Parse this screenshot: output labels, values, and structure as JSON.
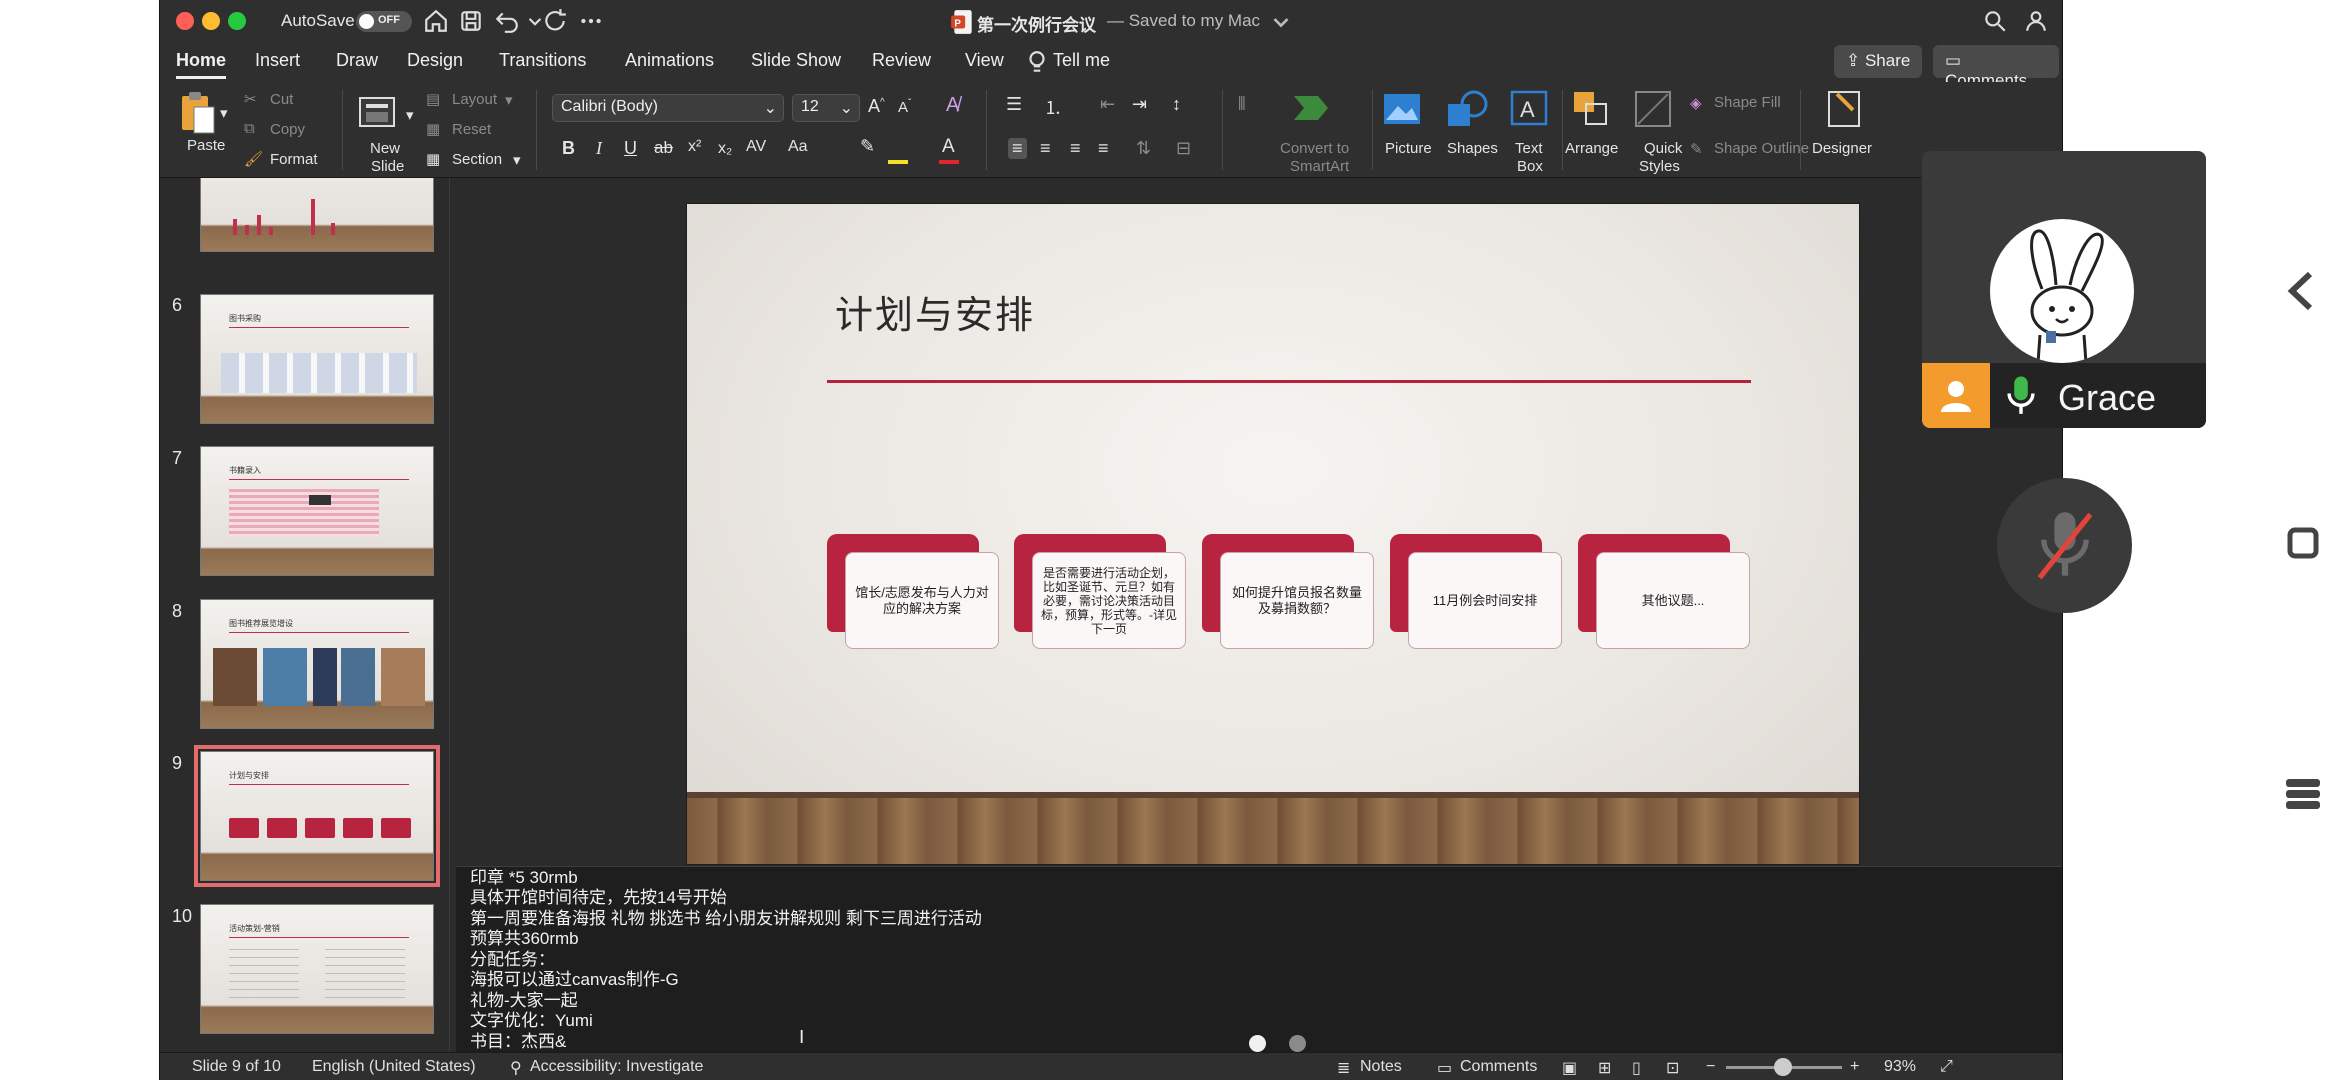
{
  "titlebar": {
    "autosave_label": "AutoSave",
    "autosave_state": "OFF",
    "doc_title": "第一次例行会议",
    "doc_status": "— Saved to my Mac"
  },
  "tabs": [
    "Home",
    "Insert",
    "Draw",
    "Design",
    "Transitions",
    "Animations",
    "Slide Show",
    "Review",
    "View",
    "Tell me"
  ],
  "active_tab": "Home",
  "share_label": "Share",
  "comments_label": "Comments",
  "ribbon": {
    "paste": "Paste",
    "cut": "Cut",
    "copy": "Copy",
    "format": "Format",
    "new_slide": "New\nSlide",
    "new_slide_l1": "New",
    "new_slide_l2": "Slide",
    "layout": "Layout",
    "reset": "Reset",
    "section": "Section",
    "font_name": "Calibri (Body)",
    "font_size": "12",
    "convert_l1": "Convert to",
    "convert_l2": "SmartArt",
    "picture": "Picture",
    "shapes": "Shapes",
    "textbox_l1": "Text",
    "textbox_l2": "Box",
    "arrange": "Arrange",
    "quick_l1": "Quick",
    "quick_l2": "Styles",
    "shape_fill": "Shape Fill",
    "shape_outline": "Shape Outline",
    "designer": "Designer"
  },
  "thumbnails": [
    {
      "num": "6",
      "title": "图书采购"
    },
    {
      "num": "7",
      "title": "书籍录入"
    },
    {
      "num": "8",
      "title": "图书推荐展览增设"
    },
    {
      "num": "9",
      "title": "计划与安排"
    },
    {
      "num": "10",
      "title": "活动策划-营销"
    }
  ],
  "selected_slide": "9",
  "slide": {
    "title": "计划与安排",
    "cards": [
      "馆长/志愿发布与人力对应的解决方案",
      "是否需要进行活动企划，比如圣诞节、元旦？如有必要，需讨论决策活动目标，预算，形式等。-详见下一页",
      "如何提升馆员报名数量及募捐数额？",
      "11月例会时间安排",
      "其他议题..."
    ]
  },
  "notes": [
    "印章 *5 30rmb",
    "具体开馆时间待定，先按14号开始",
    "第一周要准备海报 礼物 挑选书 给小朋友讲解规则 剩下三周进行活动",
    "预算共360rmb",
    "分配任务：",
    "海报可以通过canvas制作-G",
    "礼物-大家一起",
    "文字优化：Yumi",
    "书目：杰西&"
  ],
  "status": {
    "slide_pos": "Slide 9 of 10",
    "language": "English (United States)",
    "accessibility": "Accessibility: Investigate",
    "notes": "Notes",
    "comments": "Comments",
    "zoom": "93%"
  },
  "meeting": {
    "participant_name": "Grace"
  },
  "colors": {
    "accent_red": "#b5223e",
    "thumb_selected": "#e36b6b",
    "avatar_orange": "#f39c2d",
    "mic_green": "#3fb94a"
  }
}
